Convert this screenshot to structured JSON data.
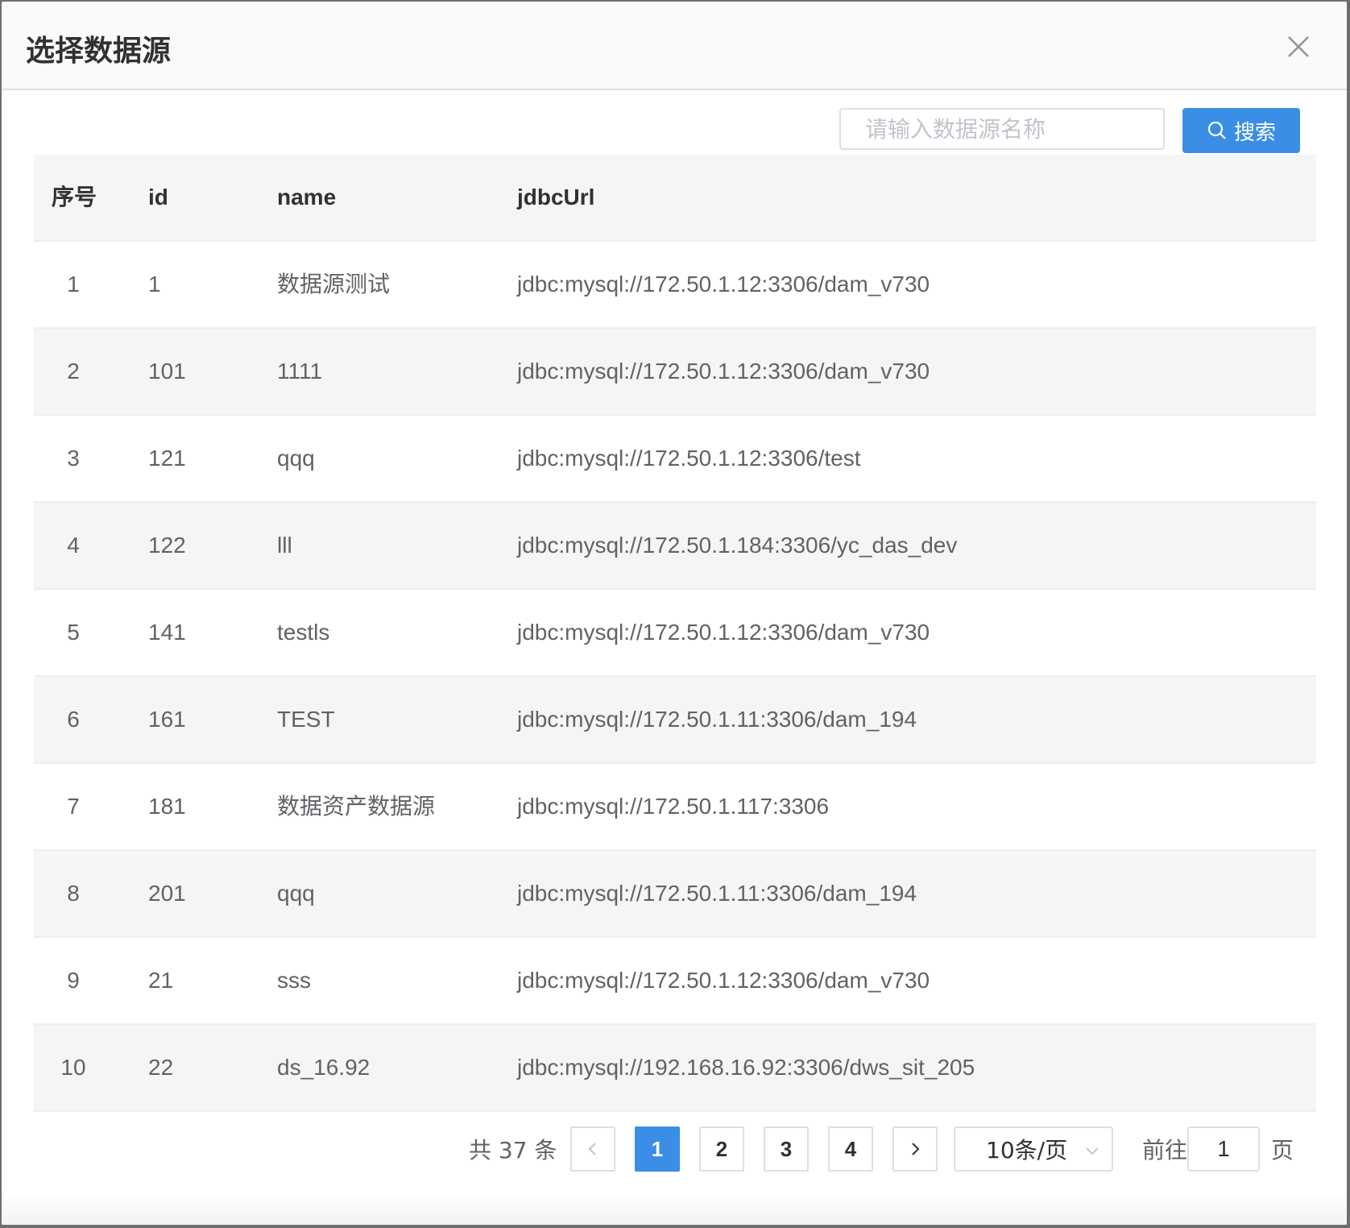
{
  "dialog": {
    "title": "选择数据源",
    "close_icon": "close-icon"
  },
  "search": {
    "placeholder": "请输入数据源名称",
    "value": "",
    "button_label": "搜索",
    "button_icon": "search-icon"
  },
  "table": {
    "headers": [
      "序号",
      "id",
      "name",
      "jdbcUrl"
    ],
    "rows": [
      {
        "seq": "1",
        "id": "1",
        "name": "数据源测试",
        "url": "jdbc:mysql://172.50.1.12:3306/dam_v730"
      },
      {
        "seq": "2",
        "id": "101",
        "name": "1111",
        "url": "jdbc:mysql://172.50.1.12:3306/dam_v730"
      },
      {
        "seq": "3",
        "id": "121",
        "name": "qqq",
        "url": "jdbc:mysql://172.50.1.12:3306/test"
      },
      {
        "seq": "4",
        "id": "122",
        "name": "lll",
        "url": "jdbc:mysql://172.50.1.184:3306/yc_das_dev"
      },
      {
        "seq": "5",
        "id": "141",
        "name": "testls",
        "url": "jdbc:mysql://172.50.1.12:3306/dam_v730"
      },
      {
        "seq": "6",
        "id": "161",
        "name": "TEST",
        "url": "jdbc:mysql://172.50.1.11:3306/dam_194"
      },
      {
        "seq": "7",
        "id": "181",
        "name": "数据资产数据源",
        "url": "jdbc:mysql://172.50.1.117:3306"
      },
      {
        "seq": "8",
        "id": "201",
        "name": "qqq",
        "url": "jdbc:mysql://172.50.1.11:3306/dam_194"
      },
      {
        "seq": "9",
        "id": "21",
        "name": "sss",
        "url": "jdbc:mysql://172.50.1.12:3306/dam_v730"
      },
      {
        "seq": "10",
        "id": "22",
        "name": "ds_16.92",
        "url": "jdbc:mysql://192.168.16.92:3306/dws_sit_205"
      }
    ]
  },
  "pagination": {
    "total_text": "共 37 条",
    "pages": [
      "1",
      "2",
      "3",
      "4"
    ],
    "current_page": "1",
    "page_size_label": "10条/页",
    "goto_label": "前往",
    "goto_value": "1",
    "page_suffix": "页"
  },
  "colors": {
    "primary": "#3a8ee6",
    "stripe": "#f5f5f5",
    "border": "#dcdfe6"
  }
}
